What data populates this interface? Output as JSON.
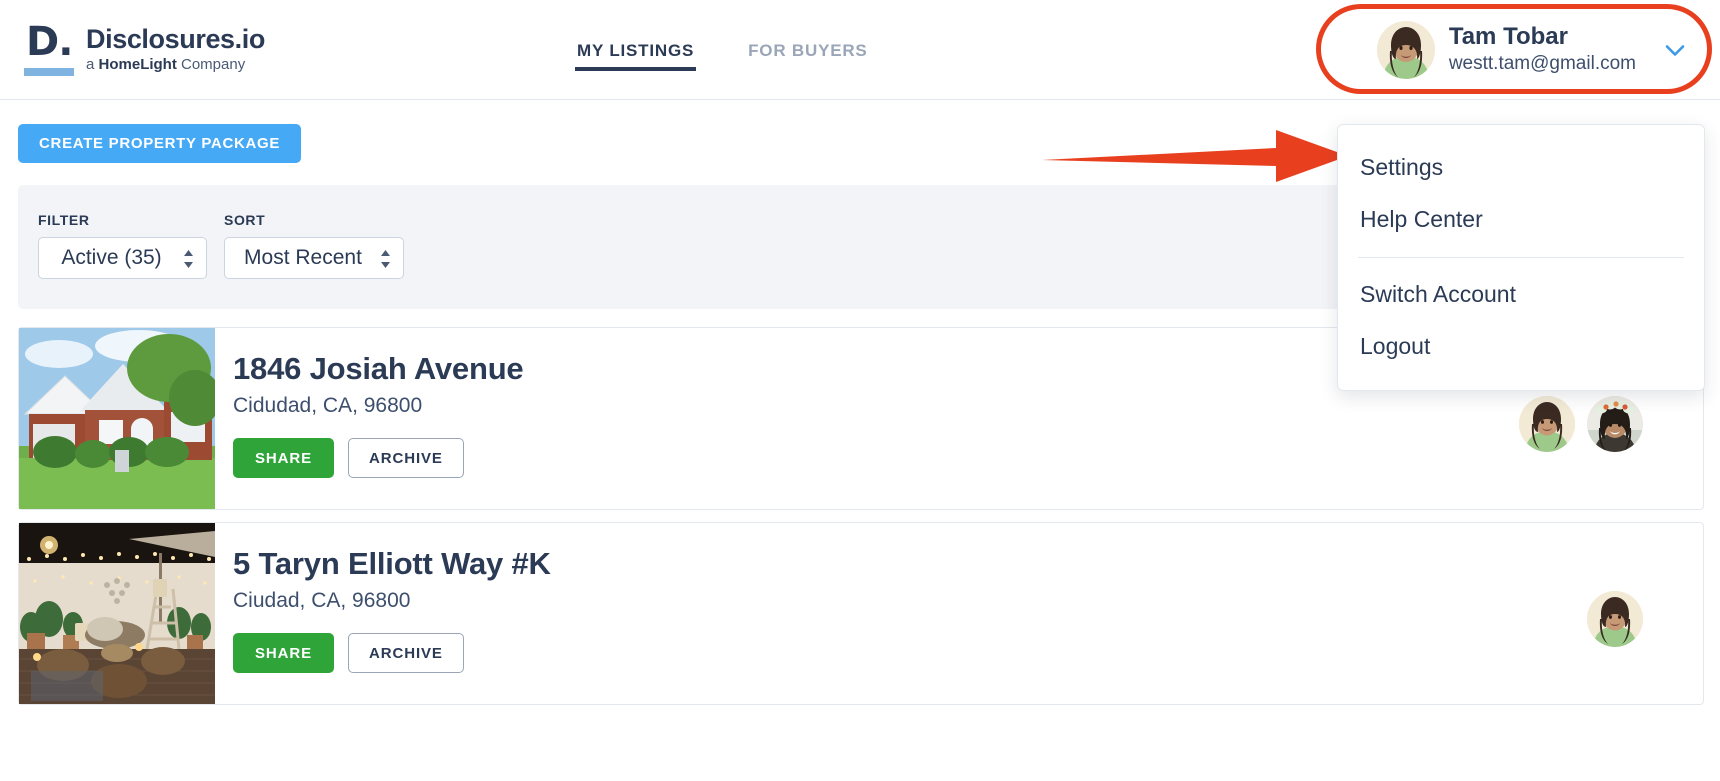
{
  "header": {
    "logo": {
      "mark": "D.",
      "title": "Disclosures.io",
      "subtitle_pre": "a ",
      "subtitle_brand": "HomeLight",
      "subtitle_post": " Company"
    },
    "nav": [
      {
        "label": "MY LISTINGS",
        "active": true
      },
      {
        "label": "FOR BUYERS",
        "active": false
      }
    ],
    "profile": {
      "name": "Tam Tobar",
      "email": "westt.tam@gmail.com",
      "chevron_icon": "chevron-down-icon",
      "avatar_icon": "user-avatar"
    }
  },
  "annotations": {
    "highlight_color": "#e8401f",
    "arrow_target": "Settings"
  },
  "dropdown": {
    "items": [
      {
        "label": "Settings"
      },
      {
        "label": "Help Center"
      },
      {
        "label": "Switch Account"
      },
      {
        "label": "Logout"
      }
    ]
  },
  "toolbar": {
    "create_label": "CREATE PROPERTY PACKAGE",
    "filter_label": "FILTER",
    "filter_value": "Active (35)",
    "sort_label": "SORT",
    "sort_value": "Most Recent"
  },
  "listings": [
    {
      "address": "1846 Josiah Avenue",
      "city": "Cidudad, CA, 96800",
      "share_label": "SHARE",
      "archive_label": "ARCHIVE",
      "thumb_icon": "brick-house-photo",
      "avatar_count": 2
    },
    {
      "address": "5 Taryn Elliott Way #K",
      "city": "Ciudad, CA, 96800",
      "share_label": "SHARE",
      "archive_label": "ARCHIVE",
      "thumb_icon": "night-patio-photo",
      "avatar_count": 1
    }
  ],
  "colors": {
    "brand_navy": "#2b3a55",
    "cta_blue": "#46a9f6",
    "share_green": "#2fa539",
    "annotation_red": "#e8401f",
    "logo_bar_blue": "#7fb4e0"
  }
}
